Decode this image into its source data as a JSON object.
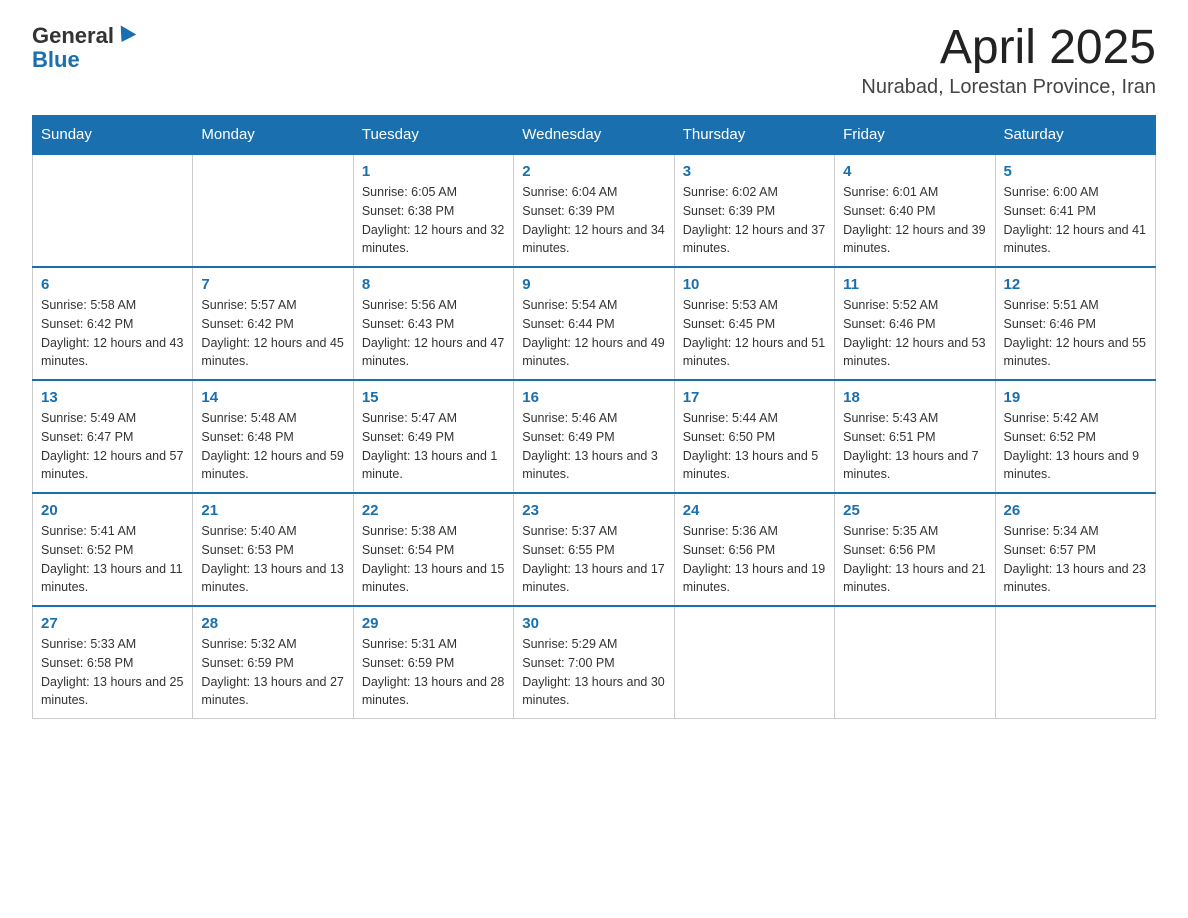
{
  "header": {
    "logo_general": "General",
    "logo_blue": "Blue",
    "month_year": "April 2025",
    "location": "Nurabad, Lorestan Province, Iran"
  },
  "weekdays": [
    "Sunday",
    "Monday",
    "Tuesday",
    "Wednesday",
    "Thursday",
    "Friday",
    "Saturday"
  ],
  "weeks": [
    [
      {
        "day": "",
        "sunrise": "",
        "sunset": "",
        "daylight": ""
      },
      {
        "day": "",
        "sunrise": "",
        "sunset": "",
        "daylight": ""
      },
      {
        "day": "1",
        "sunrise": "Sunrise: 6:05 AM",
        "sunset": "Sunset: 6:38 PM",
        "daylight": "Daylight: 12 hours and 32 minutes."
      },
      {
        "day": "2",
        "sunrise": "Sunrise: 6:04 AM",
        "sunset": "Sunset: 6:39 PM",
        "daylight": "Daylight: 12 hours and 34 minutes."
      },
      {
        "day": "3",
        "sunrise": "Sunrise: 6:02 AM",
        "sunset": "Sunset: 6:39 PM",
        "daylight": "Daylight: 12 hours and 37 minutes."
      },
      {
        "day": "4",
        "sunrise": "Sunrise: 6:01 AM",
        "sunset": "Sunset: 6:40 PM",
        "daylight": "Daylight: 12 hours and 39 minutes."
      },
      {
        "day": "5",
        "sunrise": "Sunrise: 6:00 AM",
        "sunset": "Sunset: 6:41 PM",
        "daylight": "Daylight: 12 hours and 41 minutes."
      }
    ],
    [
      {
        "day": "6",
        "sunrise": "Sunrise: 5:58 AM",
        "sunset": "Sunset: 6:42 PM",
        "daylight": "Daylight: 12 hours and 43 minutes."
      },
      {
        "day": "7",
        "sunrise": "Sunrise: 5:57 AM",
        "sunset": "Sunset: 6:42 PM",
        "daylight": "Daylight: 12 hours and 45 minutes."
      },
      {
        "day": "8",
        "sunrise": "Sunrise: 5:56 AM",
        "sunset": "Sunset: 6:43 PM",
        "daylight": "Daylight: 12 hours and 47 minutes."
      },
      {
        "day": "9",
        "sunrise": "Sunrise: 5:54 AM",
        "sunset": "Sunset: 6:44 PM",
        "daylight": "Daylight: 12 hours and 49 minutes."
      },
      {
        "day": "10",
        "sunrise": "Sunrise: 5:53 AM",
        "sunset": "Sunset: 6:45 PM",
        "daylight": "Daylight: 12 hours and 51 minutes."
      },
      {
        "day": "11",
        "sunrise": "Sunrise: 5:52 AM",
        "sunset": "Sunset: 6:46 PM",
        "daylight": "Daylight: 12 hours and 53 minutes."
      },
      {
        "day": "12",
        "sunrise": "Sunrise: 5:51 AM",
        "sunset": "Sunset: 6:46 PM",
        "daylight": "Daylight: 12 hours and 55 minutes."
      }
    ],
    [
      {
        "day": "13",
        "sunrise": "Sunrise: 5:49 AM",
        "sunset": "Sunset: 6:47 PM",
        "daylight": "Daylight: 12 hours and 57 minutes."
      },
      {
        "day": "14",
        "sunrise": "Sunrise: 5:48 AM",
        "sunset": "Sunset: 6:48 PM",
        "daylight": "Daylight: 12 hours and 59 minutes."
      },
      {
        "day": "15",
        "sunrise": "Sunrise: 5:47 AM",
        "sunset": "Sunset: 6:49 PM",
        "daylight": "Daylight: 13 hours and 1 minute."
      },
      {
        "day": "16",
        "sunrise": "Sunrise: 5:46 AM",
        "sunset": "Sunset: 6:49 PM",
        "daylight": "Daylight: 13 hours and 3 minutes."
      },
      {
        "day": "17",
        "sunrise": "Sunrise: 5:44 AM",
        "sunset": "Sunset: 6:50 PM",
        "daylight": "Daylight: 13 hours and 5 minutes."
      },
      {
        "day": "18",
        "sunrise": "Sunrise: 5:43 AM",
        "sunset": "Sunset: 6:51 PM",
        "daylight": "Daylight: 13 hours and 7 minutes."
      },
      {
        "day": "19",
        "sunrise": "Sunrise: 5:42 AM",
        "sunset": "Sunset: 6:52 PM",
        "daylight": "Daylight: 13 hours and 9 minutes."
      }
    ],
    [
      {
        "day": "20",
        "sunrise": "Sunrise: 5:41 AM",
        "sunset": "Sunset: 6:52 PM",
        "daylight": "Daylight: 13 hours and 11 minutes."
      },
      {
        "day": "21",
        "sunrise": "Sunrise: 5:40 AM",
        "sunset": "Sunset: 6:53 PM",
        "daylight": "Daylight: 13 hours and 13 minutes."
      },
      {
        "day": "22",
        "sunrise": "Sunrise: 5:38 AM",
        "sunset": "Sunset: 6:54 PM",
        "daylight": "Daylight: 13 hours and 15 minutes."
      },
      {
        "day": "23",
        "sunrise": "Sunrise: 5:37 AM",
        "sunset": "Sunset: 6:55 PM",
        "daylight": "Daylight: 13 hours and 17 minutes."
      },
      {
        "day": "24",
        "sunrise": "Sunrise: 5:36 AM",
        "sunset": "Sunset: 6:56 PM",
        "daylight": "Daylight: 13 hours and 19 minutes."
      },
      {
        "day": "25",
        "sunrise": "Sunrise: 5:35 AM",
        "sunset": "Sunset: 6:56 PM",
        "daylight": "Daylight: 13 hours and 21 minutes."
      },
      {
        "day": "26",
        "sunrise": "Sunrise: 5:34 AM",
        "sunset": "Sunset: 6:57 PM",
        "daylight": "Daylight: 13 hours and 23 minutes."
      }
    ],
    [
      {
        "day": "27",
        "sunrise": "Sunrise: 5:33 AM",
        "sunset": "Sunset: 6:58 PM",
        "daylight": "Daylight: 13 hours and 25 minutes."
      },
      {
        "day": "28",
        "sunrise": "Sunrise: 5:32 AM",
        "sunset": "Sunset: 6:59 PM",
        "daylight": "Daylight: 13 hours and 27 minutes."
      },
      {
        "day": "29",
        "sunrise": "Sunrise: 5:31 AM",
        "sunset": "Sunset: 6:59 PM",
        "daylight": "Daylight: 13 hours and 28 minutes."
      },
      {
        "day": "30",
        "sunrise": "Sunrise: 5:29 AM",
        "sunset": "Sunset: 7:00 PM",
        "daylight": "Daylight: 13 hours and 30 minutes."
      },
      {
        "day": "",
        "sunrise": "",
        "sunset": "",
        "daylight": ""
      },
      {
        "day": "",
        "sunrise": "",
        "sunset": "",
        "daylight": ""
      },
      {
        "day": "",
        "sunrise": "",
        "sunset": "",
        "daylight": ""
      }
    ]
  ]
}
